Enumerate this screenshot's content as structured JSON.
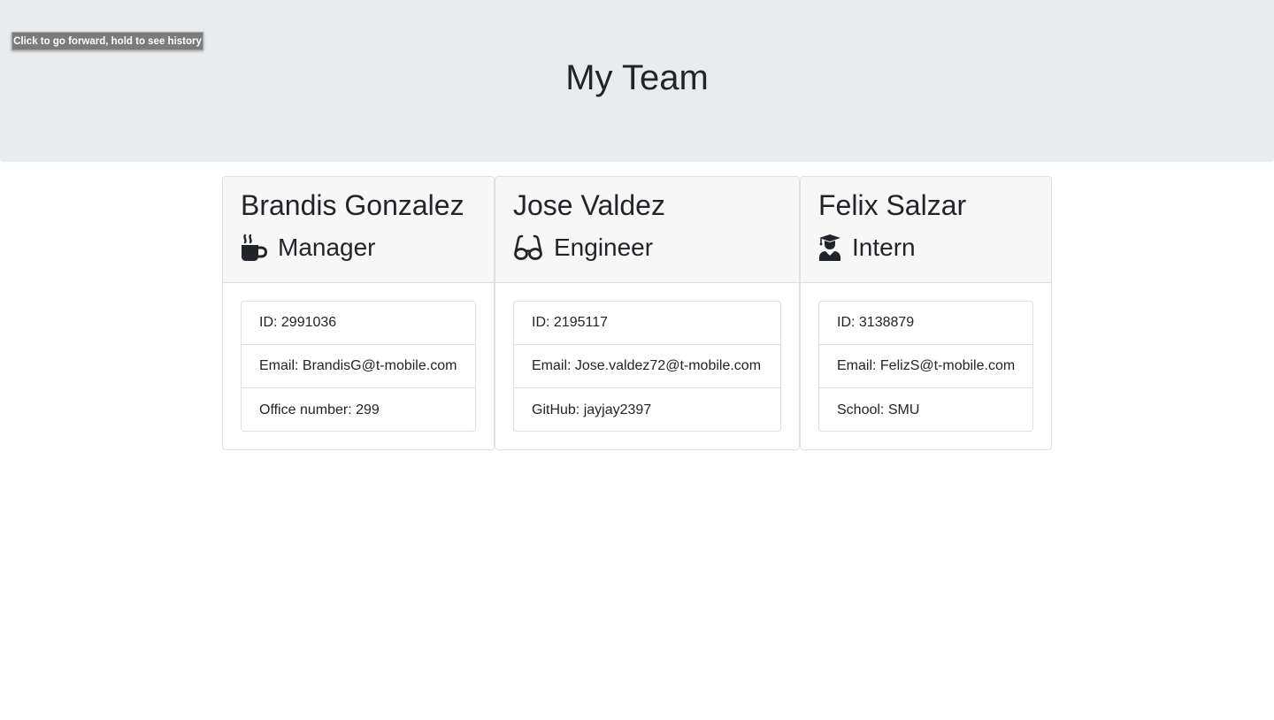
{
  "browser": {
    "tooltip": "Click to go forward, hold to see history"
  },
  "header": {
    "title": "My Team"
  },
  "team": [
    {
      "name": "Brandis Gonzalez",
      "role": "Manager",
      "role_icon": "mug-hot-icon",
      "id_text": "ID: 2991036",
      "email_prefix": "Email: ",
      "email": "BrandisG@t-mobile.com",
      "extra_text": "Office number: 299"
    },
    {
      "name": "Jose Valdez",
      "role": "Engineer",
      "role_icon": "glasses-icon",
      "id_text": "ID: 2195117",
      "email_prefix": "Email: ",
      "email": "Jose.valdez72@t-mobile.com",
      "extra_prefix": "GitHub: ",
      "github": "jayjay2397"
    },
    {
      "name": "Felix Salzar",
      "role": "Intern",
      "role_icon": "user-graduate-icon",
      "id_text": "ID: 3138879",
      "email_prefix": "Email: ",
      "email": "FelizS@t-mobile.com",
      "extra_text": "School: SMU"
    }
  ],
  "colors": {
    "header_bg": "#e9ecef",
    "card_header_bg": "#f7f7f7",
    "border": "#dfdfdf",
    "text": "#212529"
  }
}
